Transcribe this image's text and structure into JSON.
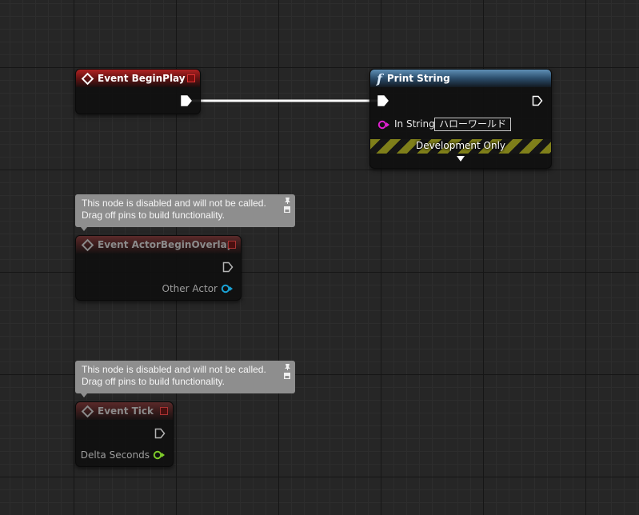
{
  "nodes": {
    "begin_play": {
      "title": "Event BeginPlay"
    },
    "print_string": {
      "title": "Print String",
      "in_string_label": "In String",
      "in_string_value": "ハローワールド",
      "dev_only_label": "Development Only"
    },
    "actor_begin_overlap": {
      "title": "Event ActorBeginOverlap",
      "pin_label": "Other Actor"
    },
    "tick": {
      "title": "Event Tick",
      "pin_label": "Delta Seconds"
    }
  },
  "comments": [
    {
      "line1": "This node is disabled and will not be called.",
      "line2": "Drag off pins to build functionality."
    },
    {
      "line1": "This node is disabled and will not be called.",
      "line2": "Drag off pins to build functionality."
    }
  ],
  "colors": {
    "event_header": "#b02222",
    "function_header": "#5f8fb5",
    "string_pin": "#e020d0",
    "object_pin": "#1aa3d6",
    "float_pin": "#7ecb2a",
    "exec_wire": "#ffffff"
  },
  "icons": [
    "event-diamond-icon",
    "function-icon",
    "exec-pin-icon",
    "delete-icon",
    "pin-comment-icon",
    "dropdown-arrow-icon"
  ]
}
